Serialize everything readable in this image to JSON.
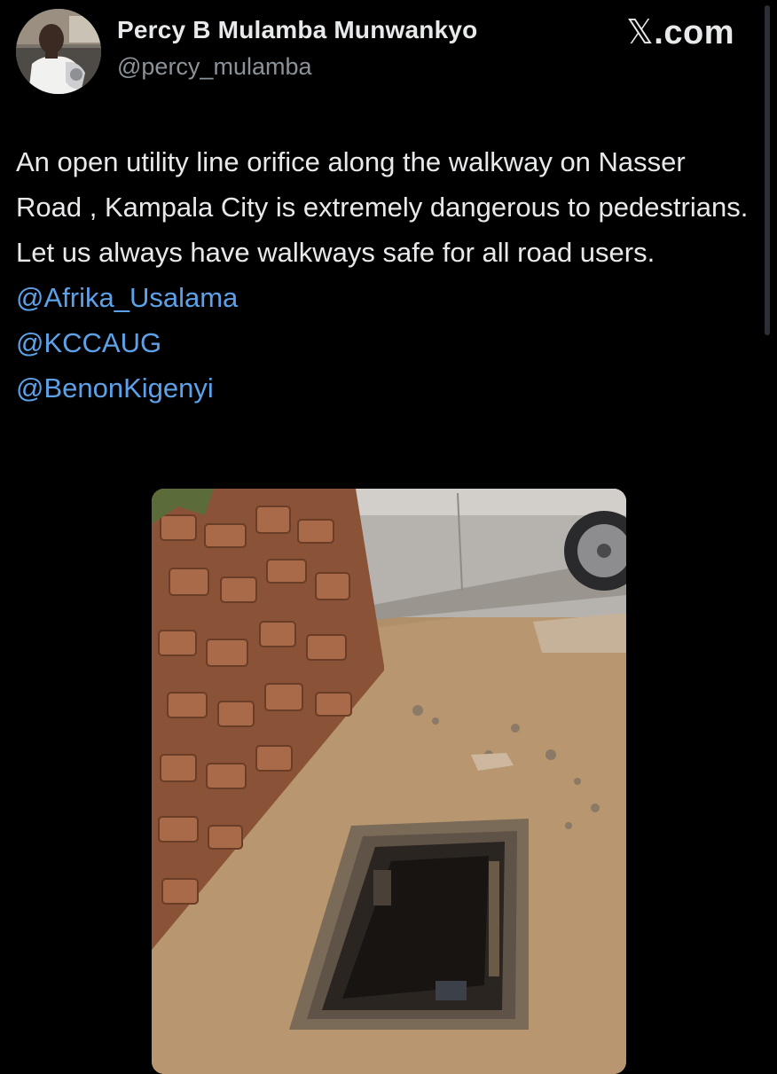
{
  "author": {
    "display_name": "Percy B Mulamba Munwankyo",
    "handle": "@percy_mulamba"
  },
  "brand": {
    "label": ".com",
    "icon": "x-logo-icon"
  },
  "tweet": {
    "text": "An open utility line orifice  along the walkway on Nasser Road , Kampala City is extremely dangerous to pedestrians.  Let us always have walkways safe for all road users.",
    "mentions": [
      "@Afrika_Usalama",
      "@KCCAUG",
      "@BenonKigenyi"
    ]
  },
  "colors": {
    "background": "#000000",
    "text": "#e7e9ea",
    "secondary_text": "#8b9299",
    "link": "#5da1e8"
  }
}
